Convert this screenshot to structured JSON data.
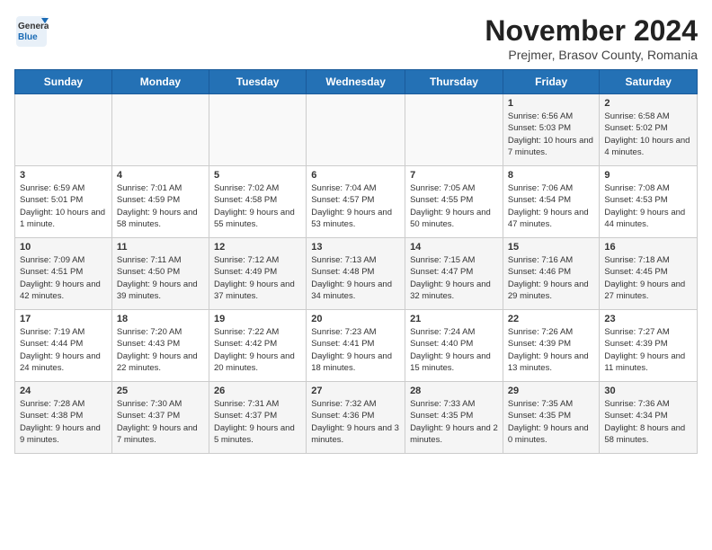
{
  "logo": {
    "general": "General",
    "blue": "Blue"
  },
  "title": "November 2024",
  "subtitle": "Prejmer, Brasov County, Romania",
  "weekdays": [
    "Sunday",
    "Monday",
    "Tuesday",
    "Wednesday",
    "Thursday",
    "Friday",
    "Saturday"
  ],
  "weeks": [
    [
      {
        "day": "",
        "info": ""
      },
      {
        "day": "",
        "info": ""
      },
      {
        "day": "",
        "info": ""
      },
      {
        "day": "",
        "info": ""
      },
      {
        "day": "",
        "info": ""
      },
      {
        "day": "1",
        "info": "Sunrise: 6:56 AM\nSunset: 5:03 PM\nDaylight: 10 hours and 7 minutes."
      },
      {
        "day": "2",
        "info": "Sunrise: 6:58 AM\nSunset: 5:02 PM\nDaylight: 10 hours and 4 minutes."
      }
    ],
    [
      {
        "day": "3",
        "info": "Sunrise: 6:59 AM\nSunset: 5:01 PM\nDaylight: 10 hours and 1 minute."
      },
      {
        "day": "4",
        "info": "Sunrise: 7:01 AM\nSunset: 4:59 PM\nDaylight: 9 hours and 58 minutes."
      },
      {
        "day": "5",
        "info": "Sunrise: 7:02 AM\nSunset: 4:58 PM\nDaylight: 9 hours and 55 minutes."
      },
      {
        "day": "6",
        "info": "Sunrise: 7:04 AM\nSunset: 4:57 PM\nDaylight: 9 hours and 53 minutes."
      },
      {
        "day": "7",
        "info": "Sunrise: 7:05 AM\nSunset: 4:55 PM\nDaylight: 9 hours and 50 minutes."
      },
      {
        "day": "8",
        "info": "Sunrise: 7:06 AM\nSunset: 4:54 PM\nDaylight: 9 hours and 47 minutes."
      },
      {
        "day": "9",
        "info": "Sunrise: 7:08 AM\nSunset: 4:53 PM\nDaylight: 9 hours and 44 minutes."
      }
    ],
    [
      {
        "day": "10",
        "info": "Sunrise: 7:09 AM\nSunset: 4:51 PM\nDaylight: 9 hours and 42 minutes."
      },
      {
        "day": "11",
        "info": "Sunrise: 7:11 AM\nSunset: 4:50 PM\nDaylight: 9 hours and 39 minutes."
      },
      {
        "day": "12",
        "info": "Sunrise: 7:12 AM\nSunset: 4:49 PM\nDaylight: 9 hours and 37 minutes."
      },
      {
        "day": "13",
        "info": "Sunrise: 7:13 AM\nSunset: 4:48 PM\nDaylight: 9 hours and 34 minutes."
      },
      {
        "day": "14",
        "info": "Sunrise: 7:15 AM\nSunset: 4:47 PM\nDaylight: 9 hours and 32 minutes."
      },
      {
        "day": "15",
        "info": "Sunrise: 7:16 AM\nSunset: 4:46 PM\nDaylight: 9 hours and 29 minutes."
      },
      {
        "day": "16",
        "info": "Sunrise: 7:18 AM\nSunset: 4:45 PM\nDaylight: 9 hours and 27 minutes."
      }
    ],
    [
      {
        "day": "17",
        "info": "Sunrise: 7:19 AM\nSunset: 4:44 PM\nDaylight: 9 hours and 24 minutes."
      },
      {
        "day": "18",
        "info": "Sunrise: 7:20 AM\nSunset: 4:43 PM\nDaylight: 9 hours and 22 minutes."
      },
      {
        "day": "19",
        "info": "Sunrise: 7:22 AM\nSunset: 4:42 PM\nDaylight: 9 hours and 20 minutes."
      },
      {
        "day": "20",
        "info": "Sunrise: 7:23 AM\nSunset: 4:41 PM\nDaylight: 9 hours and 18 minutes."
      },
      {
        "day": "21",
        "info": "Sunrise: 7:24 AM\nSunset: 4:40 PM\nDaylight: 9 hours and 15 minutes."
      },
      {
        "day": "22",
        "info": "Sunrise: 7:26 AM\nSunset: 4:39 PM\nDaylight: 9 hours and 13 minutes."
      },
      {
        "day": "23",
        "info": "Sunrise: 7:27 AM\nSunset: 4:39 PM\nDaylight: 9 hours and 11 minutes."
      }
    ],
    [
      {
        "day": "24",
        "info": "Sunrise: 7:28 AM\nSunset: 4:38 PM\nDaylight: 9 hours and 9 minutes."
      },
      {
        "day": "25",
        "info": "Sunrise: 7:30 AM\nSunset: 4:37 PM\nDaylight: 9 hours and 7 minutes."
      },
      {
        "day": "26",
        "info": "Sunrise: 7:31 AM\nSunset: 4:37 PM\nDaylight: 9 hours and 5 minutes."
      },
      {
        "day": "27",
        "info": "Sunrise: 7:32 AM\nSunset: 4:36 PM\nDaylight: 9 hours and 3 minutes."
      },
      {
        "day": "28",
        "info": "Sunrise: 7:33 AM\nSunset: 4:35 PM\nDaylight: 9 hours and 2 minutes."
      },
      {
        "day": "29",
        "info": "Sunrise: 7:35 AM\nSunset: 4:35 PM\nDaylight: 9 hours and 0 minutes."
      },
      {
        "day": "30",
        "info": "Sunrise: 7:36 AM\nSunset: 4:34 PM\nDaylight: 8 hours and 58 minutes."
      }
    ]
  ]
}
